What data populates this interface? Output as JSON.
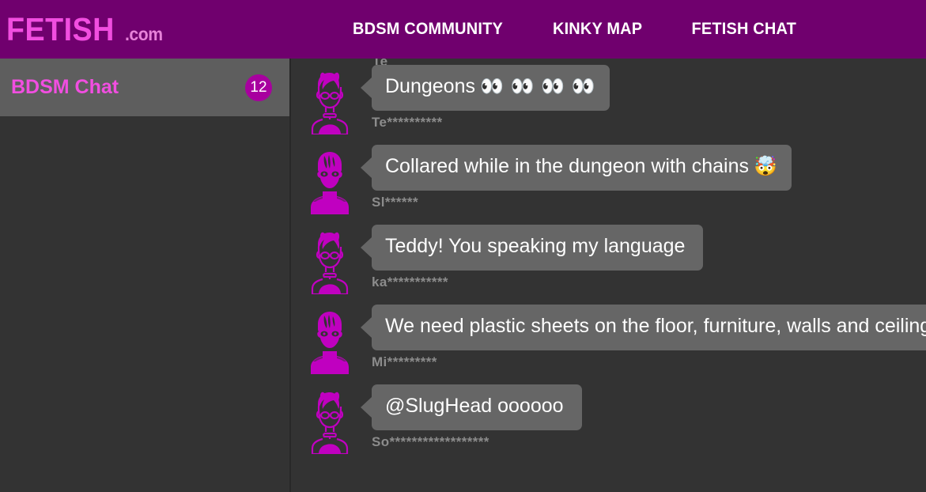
{
  "header": {
    "logo_main": "FETISH",
    "logo_tld": ".com",
    "nav": [
      {
        "label": "BDSM COMMUNITY"
      },
      {
        "label": "KINKY MAP"
      },
      {
        "label": "FETISH CHAT"
      }
    ]
  },
  "sidebar": {
    "room": {
      "label": "BDSM Chat",
      "badge": "12"
    }
  },
  "chat": {
    "clipped_username": "Te",
    "messages": [
      {
        "avatar": "female-masked-avatar",
        "text": "Dungeons",
        "emoji": "👀 👀 👀 👀",
        "username": "Te**********"
      },
      {
        "avatar": "male-masked-avatar",
        "text": "Collared while in the dungeon with chains",
        "emoji": "🤯",
        "username": "Sl******"
      },
      {
        "avatar": "female-masked-avatar",
        "text": "Teddy! You speaking my language",
        "emoji": "",
        "username": "ka***********"
      },
      {
        "avatar": "male-masked-avatar",
        "text": "We need plastic sheets on the floor, furniture, walls and ceiling",
        "emoji": "",
        "username": "Mi*********"
      },
      {
        "avatar": "female-masked-avatar",
        "text": "@SlugHead oooooo",
        "emoji": "",
        "username": "So******************"
      }
    ]
  },
  "colors": {
    "header_purple": "#70006E",
    "logo_pink": "#F14EE0",
    "chat_bg": "#333333",
    "bubble_gray": "#666666",
    "sidebar_active": "#5E5E5E",
    "badge_magenta": "#A8009F",
    "avatar_magenta": "#C000C0"
  }
}
